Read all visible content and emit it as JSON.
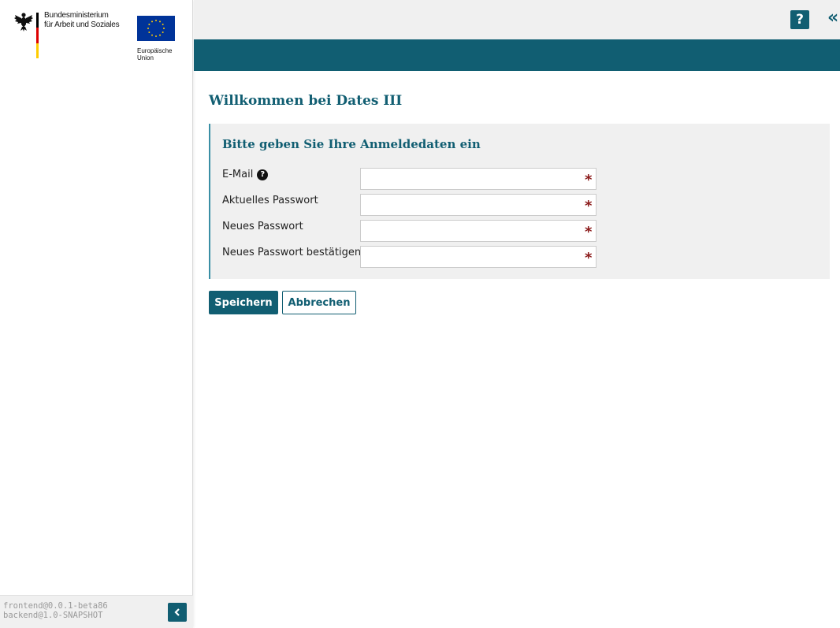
{
  "sidebar": {
    "ministry_line1": "Bundesministerium",
    "ministry_line2": "für Arbeit und Soziales",
    "eu_line1": "Europäische",
    "eu_line2": "Union",
    "version_frontend": "frontend@0.0.1-beta86",
    "version_backend": "backend@1.0-SNAPSHOT",
    "collapse_icon": "‹"
  },
  "header": {
    "help_icon": "?",
    "expand_icon": "«"
  },
  "main": {
    "title": "Willkommen bei Dates III",
    "panel_title": "Bitte geben Sie Ihre Anmeldedaten ein",
    "fields": [
      {
        "label": "E-Mail",
        "value": "",
        "required_mark": "*"
      },
      {
        "label": "Aktuelles Passwort",
        "value": "",
        "required_mark": "*"
      },
      {
        "label": "Neues Passwort",
        "value": "",
        "required_mark": "*"
      },
      {
        "label": "Neues Passwort bestätigen",
        "value": "",
        "required_mark": "*"
      }
    ],
    "save_label": "Speichern",
    "cancel_label": "Abbrechen"
  },
  "colors": {
    "brand_teal": "#115e72",
    "required_red": "#8b1a1a",
    "eu_blue": "#003399",
    "eu_gold": "#ffcc00"
  }
}
